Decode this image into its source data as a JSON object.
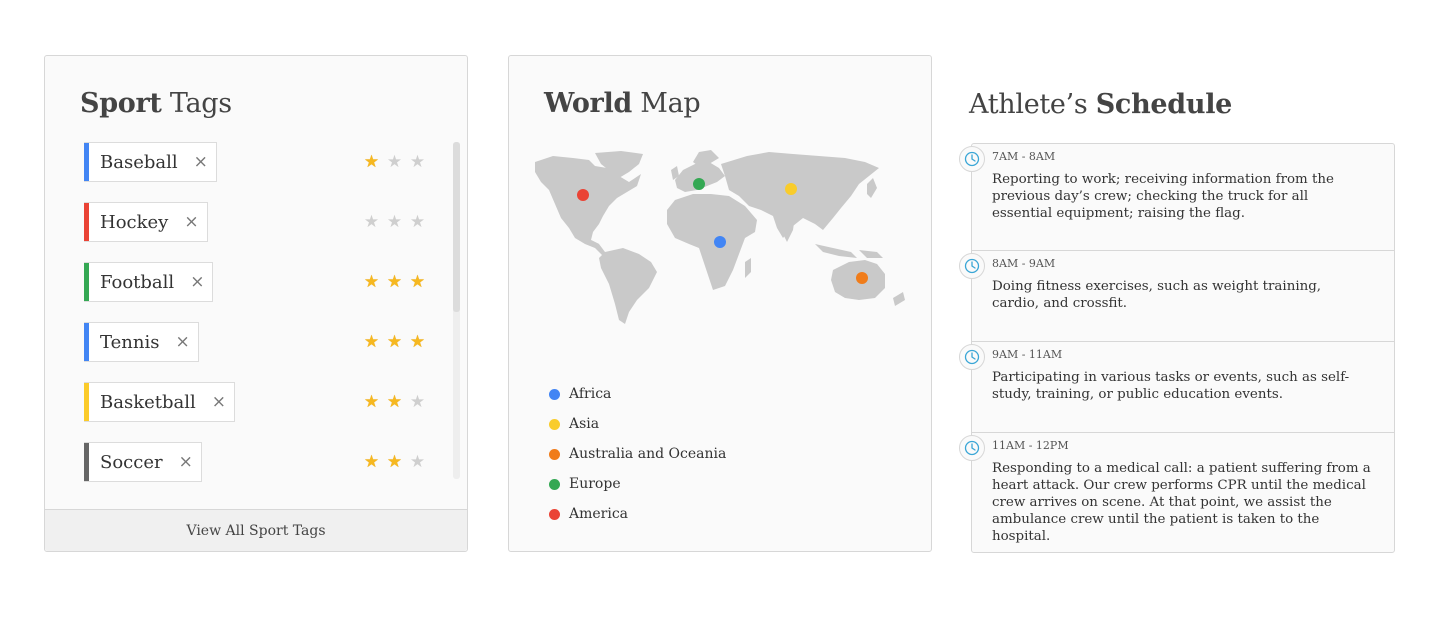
{
  "sport_tags": {
    "title_bold": "Sport",
    "title_rest": " Tags",
    "view_all_label": "View All Sport Tags",
    "close_glyph": "×",
    "star_glyph": "★",
    "tags": [
      {
        "label": "Baseball",
        "color": "#4285f4",
        "rating": 1
      },
      {
        "label": "Hockey",
        "color": "#ea4335",
        "rating": 0
      },
      {
        "label": "Football",
        "color": "#34a853",
        "rating": 3
      },
      {
        "label": "Tennis",
        "color": "#4285f4",
        "rating": 3
      },
      {
        "label": "Basketball",
        "color": "#fbcb2a",
        "rating": 2
      },
      {
        "label": "Soccer",
        "color": "#666666",
        "rating": 2
      }
    ]
  },
  "world_map": {
    "title_bold": "World",
    "title_rest": " Map",
    "legend": [
      {
        "label": "Africa",
        "color": "#4285f4"
      },
      {
        "label": "Asia",
        "color": "#f9cc2b"
      },
      {
        "label": "Australia and Oceania",
        "color": "#f07c1a"
      },
      {
        "label": "Europe",
        "color": "#34a853"
      },
      {
        "label": "America",
        "color": "#ea4335"
      }
    ]
  },
  "schedule": {
    "title_rest": "Athlete’s ",
    "title_bold": "Schedule",
    "entries": [
      {
        "time": "7AM - 8AM",
        "text": "Reporting to work; receiving information from the previous day’s crew; checking the truck for all essential equipment; raising the flag."
      },
      {
        "time": "8AM - 9AM",
        "text": "Doing fitness exercises, such as weight training, cardio, and crossfit."
      },
      {
        "time": "9AM - 11AM",
        "text": "Participating in various tasks or events, such as self-study, training, or public education events."
      },
      {
        "time": "11AM - 12PM",
        "text": "Responding to a medical call: a patient suffering from a heart attack. Our crew performs CPR until the medical crew arrives on scene. At that point, we assist the ambulance crew until the patient is taken to the hospital."
      }
    ]
  }
}
